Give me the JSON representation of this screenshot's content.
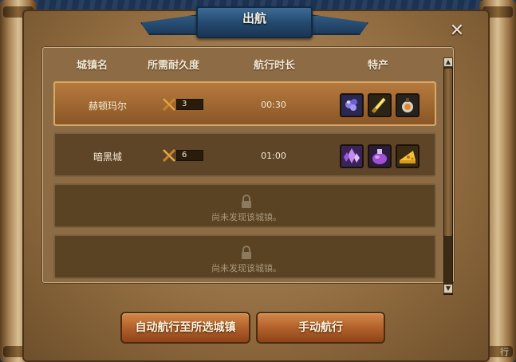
{
  "dialog": {
    "title": "出航",
    "close_glyph": "✕"
  },
  "table": {
    "headers": {
      "town": "城镇名",
      "durability": "所需耐久度",
      "duration": "航行时长",
      "specialty": "特产"
    },
    "rows": [
      {
        "town": "赫顿玛尔",
        "durability": "3",
        "duration": "00:30",
        "specialties": [
          "purple-flower-icon",
          "golden-sword-icon",
          "bottle-icon"
        ],
        "selected": true
      },
      {
        "town": "暗黑城",
        "durability": "6",
        "duration": "01:00",
        "specialties": [
          "purple-crystal-icon",
          "purple-potion-icon",
          "cheese-icon"
        ],
        "selected": false
      }
    ],
    "locked_rows": [
      {
        "text": "尚未发现该城镇。"
      },
      {
        "text": "尚未发现该城镇。"
      }
    ]
  },
  "buttons": {
    "auto_sail": "自动航行至所选城镇",
    "manual_sail": "手动航行"
  },
  "scrollbar": {
    "up_glyph": "▲",
    "down_glyph": "▼"
  },
  "corner_text": "行",
  "colors": {
    "selected_row": "#b67a3e",
    "button": "#c2702f",
    "title_banner": "#2f5a82"
  }
}
